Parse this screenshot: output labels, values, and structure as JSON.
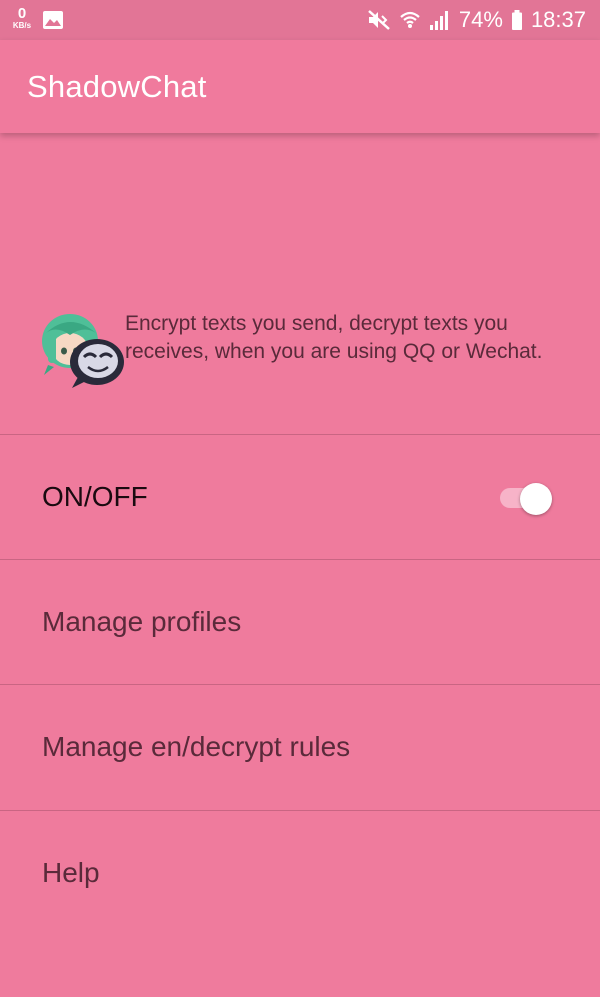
{
  "status_bar": {
    "net_speed_value": "0",
    "net_speed_unit": "KB/s",
    "battery_percent": "74%",
    "time": "18:37",
    "icons": [
      "gallery-icon",
      "mute-vibrate-icon",
      "wifi-icon",
      "signal-icon",
      "battery-icon"
    ]
  },
  "app_bar": {
    "title": "ShadowChat",
    "color": "#f07a9d"
  },
  "intro": {
    "logo_icon": "shadowchat-logo-icon",
    "description": "Encrypt texts you send, decrypt texts you receives, when you are using QQ or Wechat."
  },
  "preferences": {
    "toggle_item": {
      "label": "ON/OFF",
      "enabled": true
    },
    "manage_profiles": {
      "label": "Manage profiles"
    },
    "manage_rules": {
      "label": "Manage en/decrypt rules"
    },
    "help": {
      "label": "Help"
    }
  },
  "colors": {
    "background": "#ef7b9d",
    "status_bar": "#e27596",
    "divider": "#c96583"
  }
}
